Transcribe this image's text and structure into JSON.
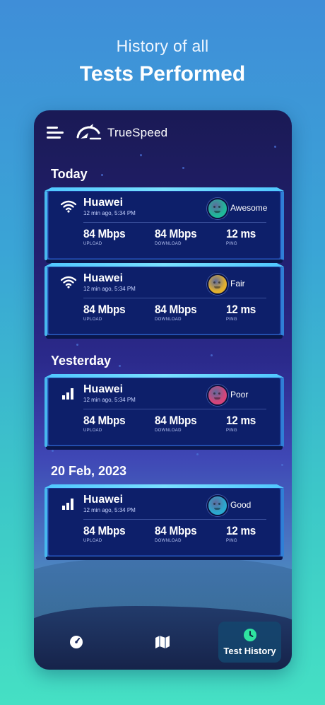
{
  "hero": {
    "subtitle": "History of all",
    "title": "Tests Performed"
  },
  "app": {
    "brand": "TrueSpeed",
    "accent": "#4fc7ff"
  },
  "sections": [
    {
      "title": "Today"
    },
    {
      "title": "Yesterday"
    },
    {
      "title": "20 Feb, 2023"
    }
  ],
  "labels": {
    "upload": "UPLOAD",
    "download": "DOWNLOAD",
    "ping": "PING"
  },
  "cards": [
    {
      "device": "Huawei",
      "time": "12 min ago, 5:34 PM",
      "network_icon": "wifi-icon",
      "mood": "Awesome",
      "mood_color": "#1fb89a",
      "upload": "84 Mbps",
      "download": "84 Mbps",
      "ping": "12 ms"
    },
    {
      "device": "Huawei",
      "time": "12 min ago, 5:34 PM",
      "network_icon": "wifi-icon",
      "mood": "Fair",
      "mood_color": "#e3b12e",
      "upload": "84 Mbps",
      "download": "84 Mbps",
      "ping": "12 ms"
    },
    {
      "device": "Huawei",
      "time": "12 min ago, 5:34 PM",
      "network_icon": "signal-bars-icon",
      "mood": "Poor",
      "mood_color": "#d6457a",
      "upload": "84 Mbps",
      "download": "84 Mbps",
      "ping": "12 ms"
    },
    {
      "device": "Huawei",
      "time": "12 min ago, 5:34 PM",
      "network_icon": "signal-bars-icon",
      "mood": "Good",
      "mood_color": "#2ba9cf",
      "upload": "84 Mbps",
      "download": "84 Mbps",
      "ping": "12 ms"
    }
  ],
  "nav": [
    {
      "icon": "speedometer-icon",
      "label": ""
    },
    {
      "icon": "map-icon",
      "label": ""
    },
    {
      "icon": "clock-icon",
      "label": "Test History",
      "active": true,
      "active_color": "#2fe3a0"
    }
  ]
}
